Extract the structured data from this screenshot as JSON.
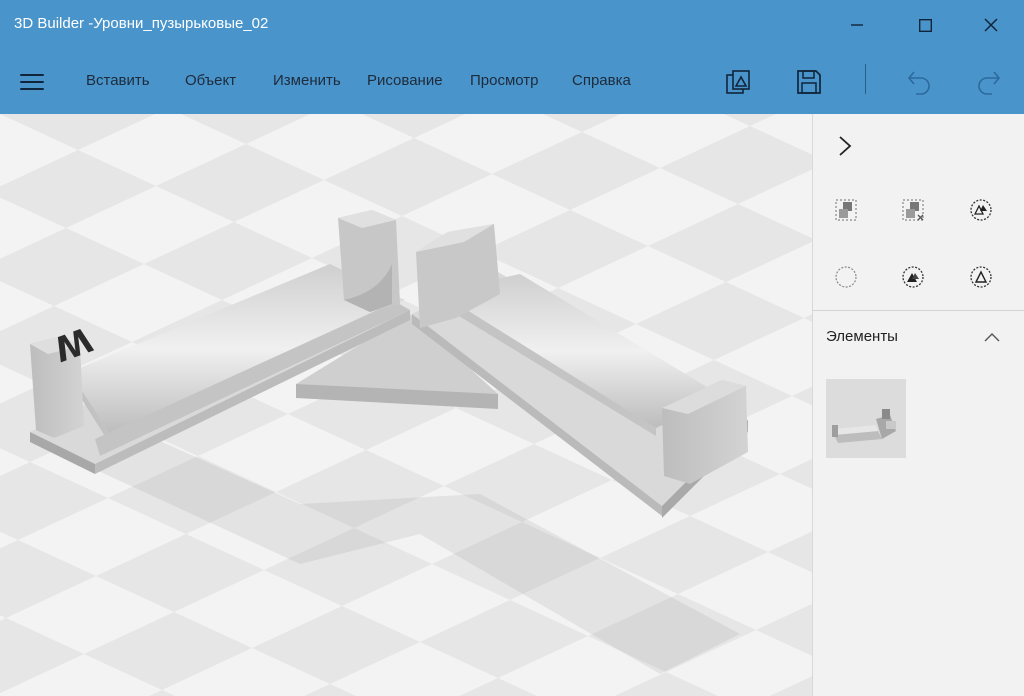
{
  "window": {
    "title": "3D Builder -Уровни_пузырьковые_02",
    "controls": [
      "minimize-icon",
      "maximize-icon",
      "close-icon"
    ]
  },
  "menu": {
    "items": [
      "Вставить",
      "Объект",
      "Изменить",
      "Рисование",
      "Просмотр",
      "Справка"
    ],
    "commands": [
      "hamburger-menu-icon",
      "print-3d-icon",
      "save-icon",
      "undo-icon",
      "redo-icon"
    ]
  },
  "viewport": {
    "model_label": "W"
  },
  "panel": {
    "collapse_icon": "chevron-right-icon",
    "tools": [
      "select-all-icon",
      "deselect-icon",
      "merge-icon",
      "empty-selection-icon",
      "subtract-icon",
      "intersect-icon"
    ],
    "elements_title": "Элементы",
    "elements_toggle_icon": "chevron-up-icon"
  },
  "colors": {
    "accent": "#4a94cc",
    "menu_text": "#1d2b3a",
    "panel_bg": "#f2f2f2",
    "viewport_bg": "#e4e4e4"
  }
}
